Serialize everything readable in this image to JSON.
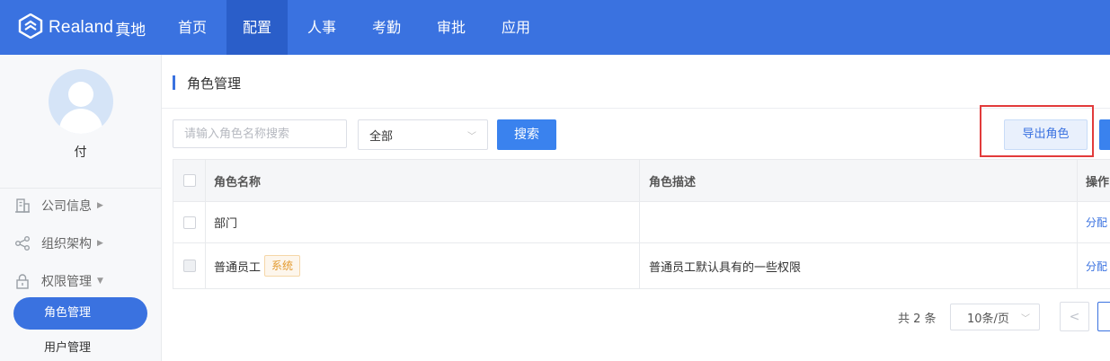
{
  "brand": {
    "name": "Realand",
    "cn": "真地"
  },
  "nav": {
    "items": [
      {
        "label": "首页",
        "active": false
      },
      {
        "label": "配置",
        "active": true
      },
      {
        "label": "人事",
        "active": false
      },
      {
        "label": "考勤",
        "active": false
      },
      {
        "label": "审批",
        "active": false
      },
      {
        "label": "应用",
        "active": false
      }
    ]
  },
  "sidebar": {
    "user_name": "付",
    "menu": [
      {
        "label": "公司信息",
        "icon": "building-icon",
        "arrow": "▶"
      },
      {
        "label": "组织架构",
        "icon": "share-icon",
        "arrow": "▶"
      },
      {
        "label": "权限管理",
        "icon": "lock-icon",
        "arrow": "▼"
      }
    ],
    "sub_items": [
      {
        "label": "角色管理",
        "active": true
      },
      {
        "label": "用户管理",
        "active": false
      }
    ]
  },
  "page": {
    "title": "角色管理"
  },
  "toolbar": {
    "search_placeholder": "请输入角色名称搜索",
    "filter_value": "全部",
    "search_label": "搜索",
    "export_label": "导出角色"
  },
  "table": {
    "headers": {
      "name": "角色名称",
      "desc": "角色描述",
      "op": "操作"
    },
    "rows": [
      {
        "name": "部门",
        "tag": "",
        "desc": "",
        "op": "分配"
      },
      {
        "name": "普通员工",
        "tag": "系统",
        "desc": "普通员工默认具有的一些权限",
        "op": "分配"
      }
    ]
  },
  "pagination": {
    "total": "共 2 条",
    "page_size": "10条/页",
    "prev": "<"
  },
  "colors": {
    "primary": "#3a72e0",
    "highlight": "#e23b3b",
    "tag": "#e39b30"
  }
}
